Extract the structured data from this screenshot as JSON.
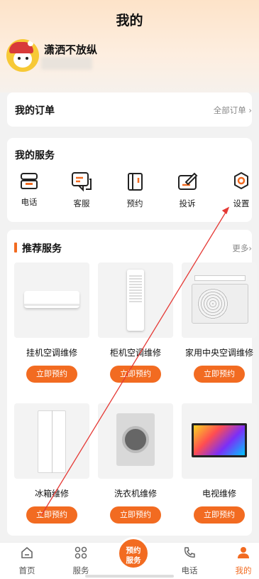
{
  "page": {
    "title": "我的"
  },
  "user": {
    "name": "潇洒不放纵"
  },
  "orders": {
    "title": "我的订单",
    "all_link": "全部订单 ›"
  },
  "services": {
    "title": "我的服务",
    "items": [
      {
        "label": "电话",
        "icon": "phone-icon"
      },
      {
        "label": "客服",
        "icon": "chat-icon"
      },
      {
        "label": "预约",
        "icon": "book-icon"
      },
      {
        "label": "投诉",
        "icon": "complaint-icon"
      },
      {
        "label": "设置",
        "icon": "gear-icon"
      }
    ]
  },
  "recommend": {
    "title": "推荐服务",
    "more": "更多›",
    "items": [
      {
        "name": "挂机空调维修",
        "button": "立即预约",
        "icon": "wall-ac-image"
      },
      {
        "name": "柜机空调维修",
        "button": "立即预约",
        "icon": "tower-ac-image"
      },
      {
        "name": "家用中央空调维修",
        "button": "立即预约",
        "icon": "central-ac-image"
      },
      {
        "name": "冰箱维修",
        "button": "立即预约",
        "icon": "fridge-image"
      },
      {
        "name": "洗衣机维修",
        "button": "立即预约",
        "icon": "washer-image"
      },
      {
        "name": "电视维修",
        "button": "立即预约",
        "icon": "tv-image"
      }
    ]
  },
  "tabbar": {
    "items": [
      {
        "label": "首页",
        "icon": "home-icon",
        "active": false
      },
      {
        "label": "服务",
        "icon": "grid-icon",
        "active": false
      },
      {
        "label": "电话",
        "icon": "phone-icon",
        "active": false
      },
      {
        "label": "我的",
        "icon": "user-icon",
        "active": true
      }
    ],
    "center_label_1": "预约",
    "center_label_2": "服务"
  },
  "colors": {
    "accent": "#f26b21",
    "annotation": "#e53935"
  }
}
